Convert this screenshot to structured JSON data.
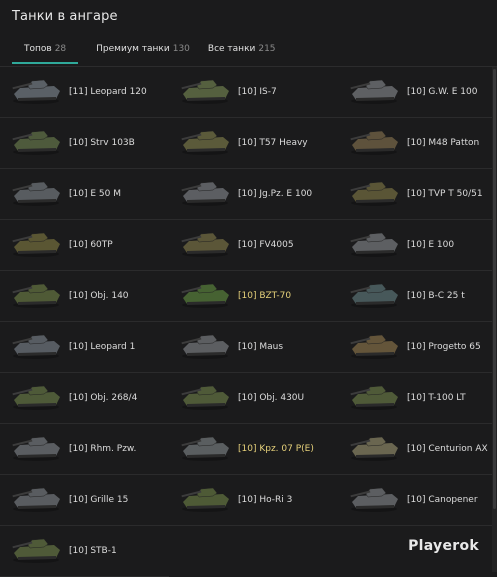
{
  "header": {
    "title": "Танки в ангаре"
  },
  "tabs": [
    {
      "label": "Топов",
      "count": "28"
    },
    {
      "label": "Премиум танки",
      "count": "130"
    },
    {
      "label": "Все танки",
      "count": "215"
    }
  ],
  "tanks": [
    {
      "name": "[11] Leopard 120",
      "premium": false,
      "hull": "#5a6066"
    },
    {
      "name": "[10] IS-7",
      "premium": false,
      "hull": "#55603f"
    },
    {
      "name": "[10] G.W. E 100",
      "premium": false,
      "hull": "#5e6063"
    },
    {
      "name": "[10] Strv 103B",
      "premium": false,
      "hull": "#4e5a3c"
    },
    {
      "name": "[10] T57 Heavy",
      "premium": false,
      "hull": "#5b5a3a"
    },
    {
      "name": "[10] M48 Patton",
      "premium": false,
      "hull": "#5e523c"
    },
    {
      "name": "[10] E 50 M",
      "premium": false,
      "hull": "#585c60"
    },
    {
      "name": "[10] Jg.Pz. E 100",
      "premium": false,
      "hull": "#5c5e62"
    },
    {
      "name": "[10] TVP T 50/51",
      "premium": false,
      "hull": "#5a5536"
    },
    {
      "name": "[10] 60TP",
      "premium": false,
      "hull": "#5a5633"
    },
    {
      "name": "[10] FV4005",
      "premium": false,
      "hull": "#5b5638"
    },
    {
      "name": "[10] E 100",
      "premium": false,
      "hull": "#5d5f62"
    },
    {
      "name": "[10] Obj. 140",
      "premium": false,
      "hull": "#4f5a36"
    },
    {
      "name": "[10] BZT-70",
      "premium": true,
      "hull": "#466232"
    },
    {
      "name": "[10] B-C 25 t",
      "premium": false,
      "hull": "#47585a"
    },
    {
      "name": "[10] Leopard 1",
      "premium": false,
      "hull": "#575c62"
    },
    {
      "name": "[10] Maus",
      "premium": false,
      "hull": "#5c5e61"
    },
    {
      "name": "[10] Progetto 65",
      "premium": false,
      "hull": "#64553a"
    },
    {
      "name": "[10] Obj. 268/4",
      "premium": false,
      "hull": "#4e5a38"
    },
    {
      "name": "[10] Obj. 430U",
      "premium": false,
      "hull": "#4f5a38"
    },
    {
      "name": "[10] T-100 LT",
      "premium": false,
      "hull": "#4f5a38"
    },
    {
      "name": "[10] Rhm. Pzw.",
      "premium": false,
      "hull": "#5a5d61"
    },
    {
      "name": "[10] Kpz. 07 P(E)",
      "premium": true,
      "hull": "#5a5e60"
    },
    {
      "name": "[10] Centurion AX",
      "premium": false,
      "hull": "#6a6650"
    },
    {
      "name": "[10] Grille 15",
      "premium": false,
      "hull": "#595c60"
    },
    {
      "name": "[10] Ho-Ri 3",
      "premium": false,
      "hull": "#4e5a36"
    },
    {
      "name": "[10] Canopener",
      "premium": false,
      "hull": "#5c5e61"
    },
    {
      "name": "[10] STB-1",
      "premium": false,
      "hull": "#4f5a38"
    }
  ],
  "watermark": "Playerok"
}
